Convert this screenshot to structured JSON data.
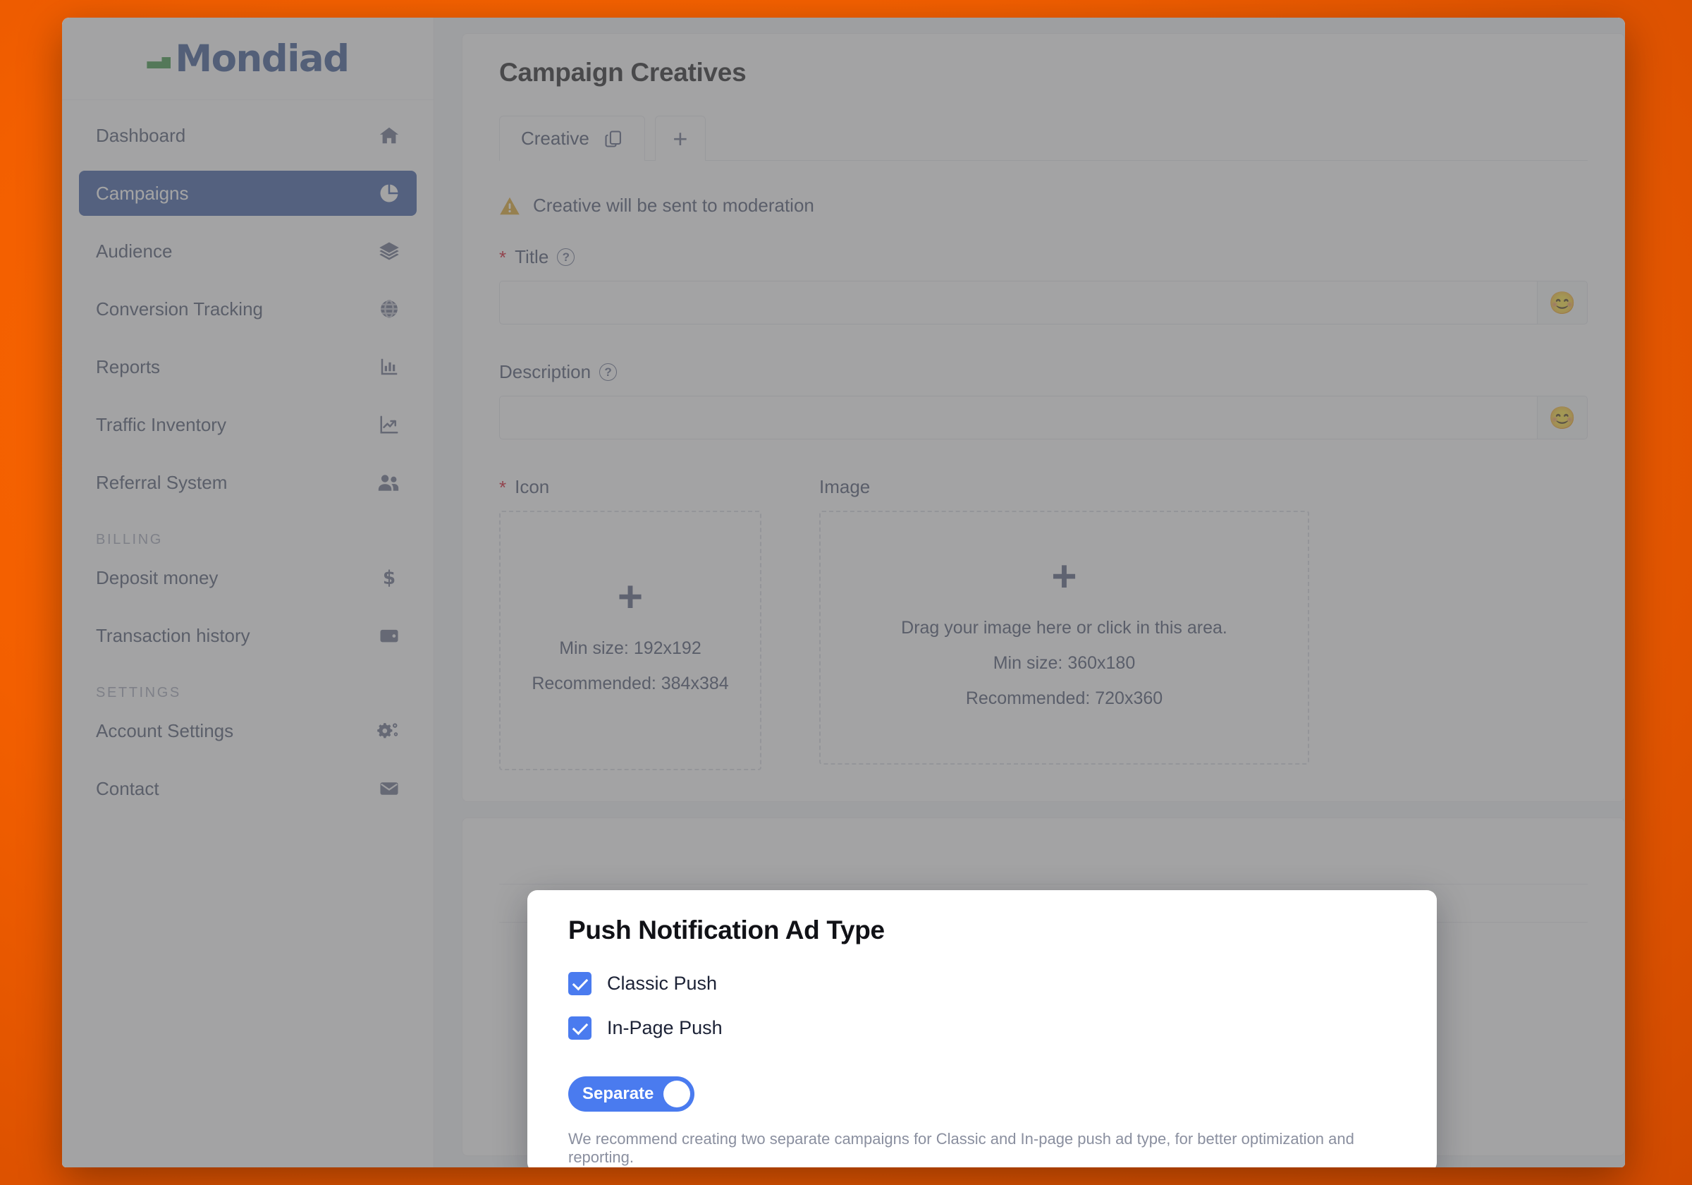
{
  "theme": {
    "background": "#fa6400",
    "brand_blue": "#2a4b8d",
    "brand_green": "#2e8b3c",
    "active_nav": "#2e4f9e",
    "accent_blue": "#4a7bef",
    "required_red": "#d0021b",
    "warning_amber": "#d9a021"
  },
  "sidebar": {
    "brand": {
      "name": "Mondiad",
      "mark": "mondiad-logo-mark"
    },
    "items": [
      {
        "label": "Dashboard",
        "icon": "home-icon",
        "active": false
      },
      {
        "label": "Campaigns",
        "icon": "pie-chart-icon",
        "active": true
      },
      {
        "label": "Audience",
        "icon": "layers-icon",
        "active": false
      },
      {
        "label": "Conversion Tracking",
        "icon": "globe-icon",
        "active": false
      },
      {
        "label": "Reports",
        "icon": "bar-chart-icon",
        "active": false
      },
      {
        "label": "Traffic Inventory",
        "icon": "trend-up-icon",
        "active": false
      },
      {
        "label": "Referral System",
        "icon": "users-icon",
        "active": false
      }
    ],
    "groups": [
      {
        "title": "BILLING",
        "items": [
          {
            "label": "Deposit money",
            "icon": "dollar-icon"
          },
          {
            "label": "Transaction history",
            "icon": "wallet-icon"
          }
        ]
      },
      {
        "title": "SETTINGS",
        "items": [
          {
            "label": "Account Settings",
            "icon": "gears-icon"
          },
          {
            "label": "Contact",
            "icon": "envelope-icon"
          }
        ]
      }
    ]
  },
  "creatives": {
    "title": "Campaign Creatives",
    "tabs": [
      {
        "label": "Creative",
        "icon": "copy-icon",
        "active": true
      }
    ],
    "add_tab_label": "+",
    "moderation_notice": {
      "icon": "warning-triangle-icon",
      "text": "Creative will be sent to moderation"
    },
    "title_field": {
      "label": "Title",
      "required_marker": "*",
      "help_icon": "question-circle-icon",
      "value": "",
      "placeholder": "",
      "emoji_button": "😊"
    },
    "description_field": {
      "label": "Description",
      "help_icon": "question-circle-icon",
      "value": "",
      "placeholder": "",
      "emoji_button": "😊"
    },
    "icon_upload": {
      "label": "Icon",
      "required_marker": "*",
      "plus": "+",
      "min_size": "Min size: 192x192",
      "recommended": "Recommended: 384x384"
    },
    "image_upload": {
      "label": "Image",
      "plus": "+",
      "prompt": "Drag your image here or click in this area.",
      "min_size": "Min size: 360x180",
      "recommended": "Recommended: 720x360"
    }
  },
  "modal": {
    "title": "Push Notification Ad Type",
    "checkboxes": [
      {
        "label": "Classic Push",
        "checked": true
      },
      {
        "label": "In-Page Push",
        "checked": true
      }
    ],
    "toggle": {
      "label": "Separate",
      "on": true
    },
    "note": "We recommend creating two separate campaigns for Classic and In-page push ad type, for better optimization and reporting."
  }
}
